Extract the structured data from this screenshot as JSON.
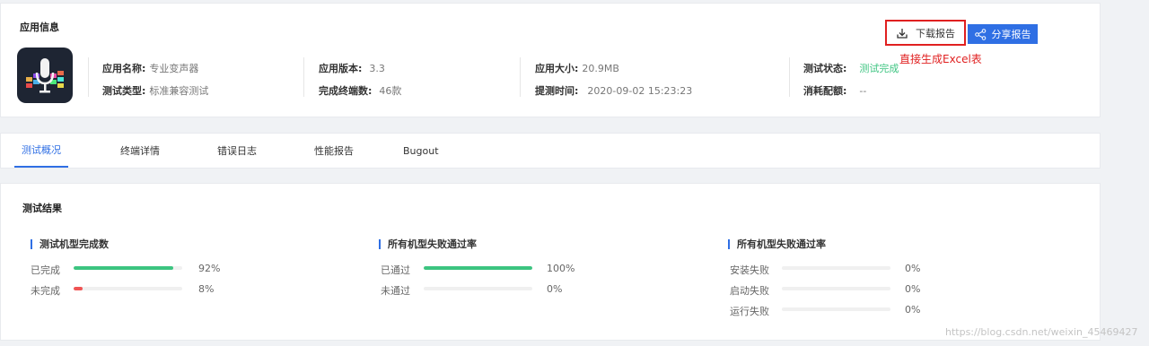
{
  "info": {
    "title": "应用信息",
    "download_label": "下载报告",
    "share_label": "分享报告",
    "annotation": "直接生成Excel表",
    "fields": {
      "app_name": {
        "key": "应用名称:",
        "value": "专业变声器"
      },
      "test_type": {
        "key": "测试类型:",
        "value": "标准兼容测试"
      },
      "app_version": {
        "key": "应用版本:",
        "value": "3.3"
      },
      "done_devices": {
        "key": "完成终端数:",
        "value": "46款"
      },
      "app_size": {
        "key": "应用大小:",
        "value": "20.9MB"
      },
      "submit_time": {
        "key": "提测时间:",
        "value": "2020-09-02 15:23:23"
      },
      "test_status": {
        "key": "测试状态:",
        "value": "测试完成"
      },
      "quota": {
        "key": "消耗配额:",
        "value": "--"
      }
    },
    "status_color": "#3cc480"
  },
  "tabs": [
    "测试概况",
    "终端详情",
    "错误日志",
    "性能报告",
    "Bugout"
  ],
  "result": {
    "title": "测试结果",
    "metrics": [
      {
        "title": "测试机型完成数",
        "rows": [
          {
            "label": "已完成",
            "value": 0.92,
            "pct": "92%",
            "color": "#3cc480"
          },
          {
            "label": "未完成",
            "value": 0.08,
            "pct": "8%",
            "color": "#f05454"
          }
        ]
      },
      {
        "title": "所有机型失败通过率",
        "rows": [
          {
            "label": "已通过",
            "value": 1.0,
            "pct": "100%",
            "color": "#3cc480"
          },
          {
            "label": "未通过",
            "value": 0,
            "pct": "0%",
            "color": "#f05454"
          }
        ]
      },
      {
        "title": "所有机型失败通过率",
        "rows": [
          {
            "label": "安装失败",
            "value": 0,
            "pct": "0%",
            "color": "#f05454"
          },
          {
            "label": "启动失败",
            "value": 0,
            "pct": "0%",
            "color": "#f05454"
          },
          {
            "label": "运行失败",
            "value": 0,
            "pct": "0%",
            "color": "#f05454"
          }
        ]
      }
    ]
  },
  "watermark": "https://blog.csdn.net/weixin_45469427",
  "colors": {
    "accent": "#2f6fe4",
    "success": "#3cc480",
    "danger": "#f05454",
    "annotation": "#e02020"
  }
}
